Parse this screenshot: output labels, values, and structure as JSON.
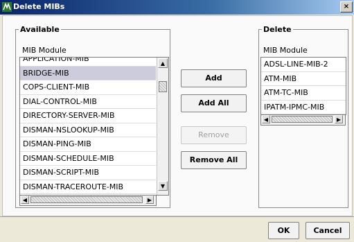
{
  "window": {
    "title": "Delete MIBs",
    "close_label": "×"
  },
  "available": {
    "group_label": "Available",
    "column_header": "MIB Module",
    "items": [
      "APPLICATION-MIB",
      "BRIDGE-MIB",
      "COPS-CLIENT-MIB",
      "DIAL-CONTROL-MIB",
      "DIRECTORY-SERVER-MIB",
      "DISMAN-NSLOOKUP-MIB",
      "DISMAN-PING-MIB",
      "DISMAN-SCHEDULE-MIB",
      "DISMAN-SCRIPT-MIB",
      "DISMAN-TRACEROUTE-MIB"
    ],
    "selected_item": "BRIDGE-MIB"
  },
  "delete": {
    "group_label": "Delete",
    "column_header": "MIB Module",
    "items": [
      "ADSL-LINE-MIB-2",
      "ATM-MIB",
      "ATM-TC-MIB",
      "IPATM-IPMC-MIB"
    ]
  },
  "actions": {
    "add": "Add",
    "add_all": "Add All",
    "remove": "Remove",
    "remove_all": "Remove All"
  },
  "footer": {
    "ok": "OK",
    "cancel": "Cancel"
  }
}
